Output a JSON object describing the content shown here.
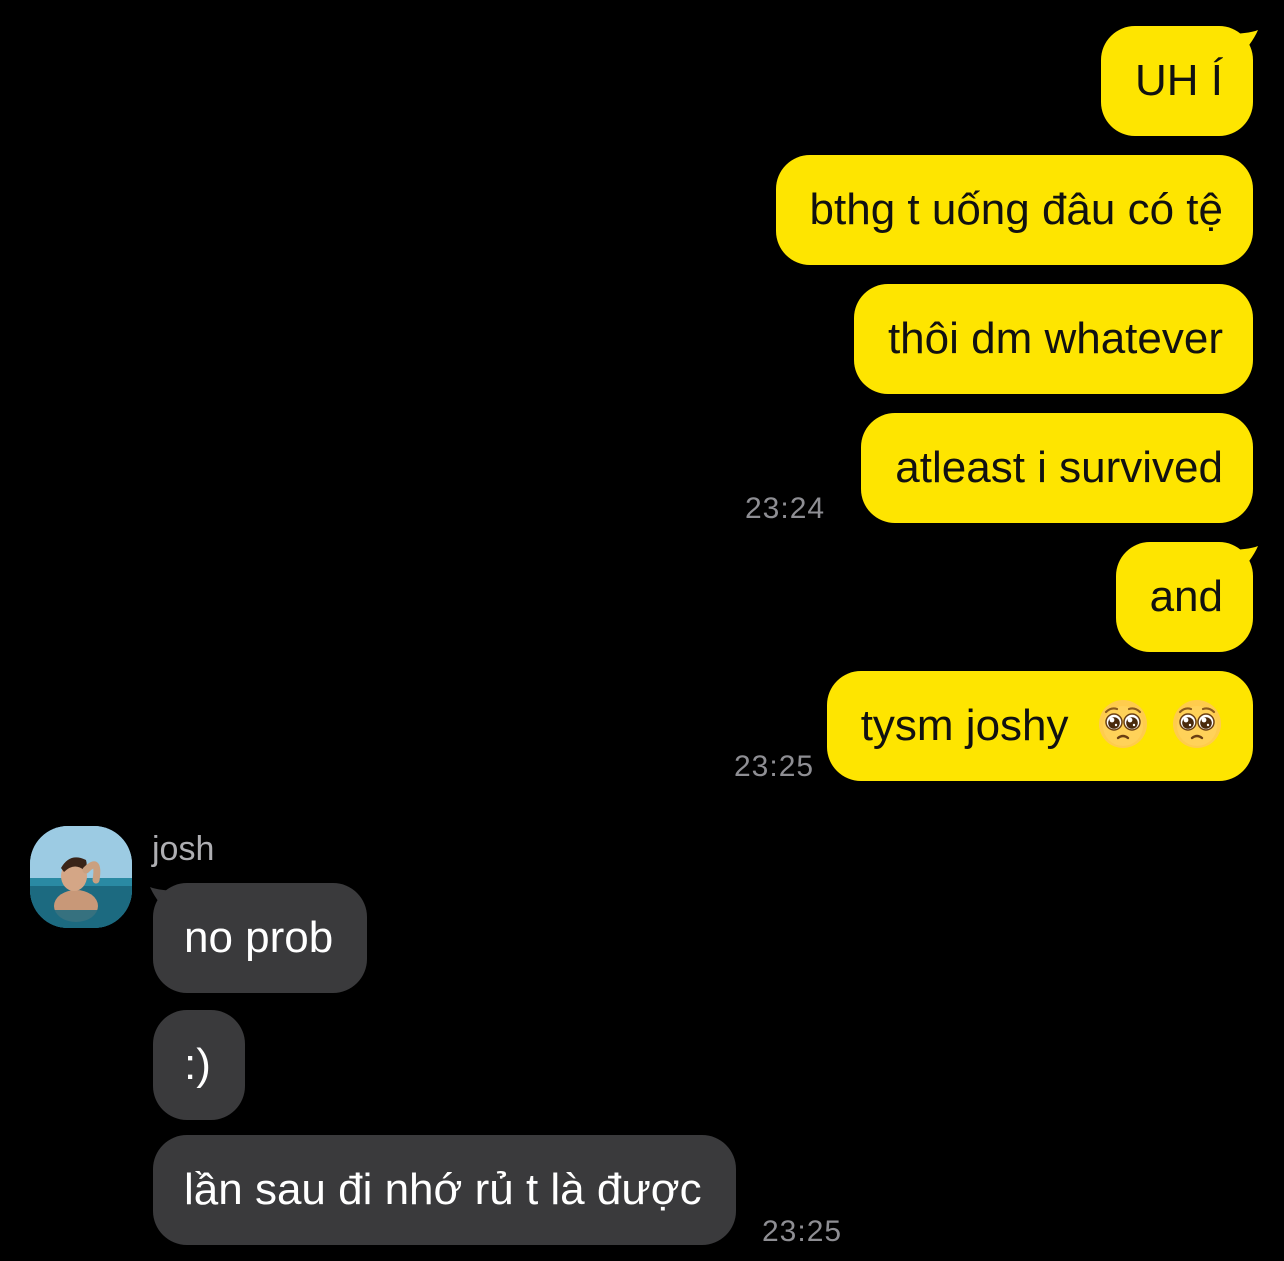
{
  "chat": {
    "outgoing": [
      {
        "text": "UH Í"
      },
      {
        "text": "bthg t uống đâu có tệ"
      },
      {
        "text": "thôi dm whatever"
      },
      {
        "text": "atleast i survived",
        "time": "23:24"
      },
      {
        "text": "and"
      },
      {
        "text": "tysm joshy",
        "emojis": [
          "pleading-face-emoji",
          "pleading-face-emoji"
        ],
        "time": "23:25"
      }
    ],
    "incoming": {
      "sender": "josh",
      "messages": [
        {
          "text": "no prob"
        },
        {
          "text": ":)"
        },
        {
          "text": "lần sau đi nhớ rủ t là được",
          "time": "23:25"
        }
      ]
    }
  },
  "colors": {
    "background": "#000000",
    "outgoing_bubble": "#FEE500",
    "incoming_bubble": "#3A3A3C",
    "timestamp": "#8E8E93"
  }
}
